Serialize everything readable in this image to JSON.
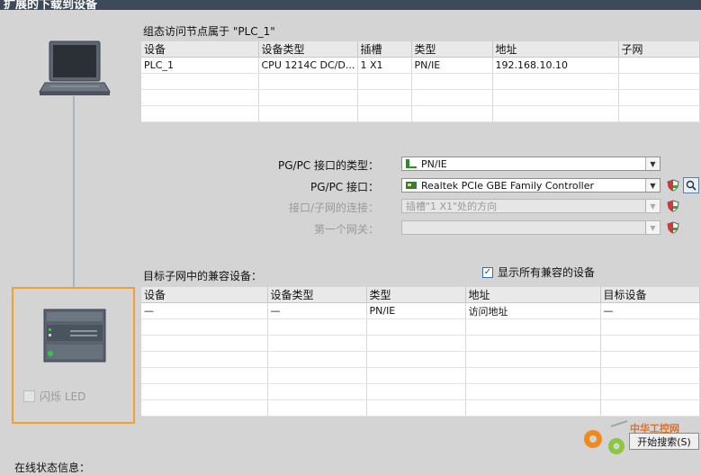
{
  "window": {
    "title": "扩展的下载到设备"
  },
  "left_panel": {
    "flash_led_label": "闪烁 LED"
  },
  "access_section": {
    "title": "组态访问节点属于 \"PLC_1\"",
    "columns": [
      "设备",
      "设备类型",
      "插槽",
      "类型",
      "地址",
      "子网"
    ],
    "rows": [
      [
        "PLC_1",
        "CPU 1214C DC/D...",
        "1 X1",
        "PN/IE",
        "192.168.10.10",
        ""
      ],
      [
        "",
        "",
        "",
        "",
        "",
        ""
      ],
      [
        "",
        "",
        "",
        "",
        "",
        ""
      ],
      [
        "",
        "",
        "",
        "",
        "",
        ""
      ]
    ]
  },
  "interface": {
    "type_label": "PG/PC 接口的类型：",
    "type_value": "PN/IE",
    "pgpc_label": "PG/PC 接口：",
    "pgpc_value": "Realtek PCIe GBE Family Controller",
    "conn_label": "接口/子网的连接：",
    "conn_value": "插槽\"1 X1\"处的方向",
    "gateway_label": "第一个网关：",
    "gateway_value": ""
  },
  "compatible": {
    "title": "目标子网中的兼容设备：",
    "show_all_label": "显示所有兼容的设备",
    "columns": [
      "设备",
      "设备类型",
      "类型",
      "地址",
      "目标设备"
    ],
    "rows": [
      [
        "—",
        "—",
        "PN/IE",
        "访问地址",
        "—"
      ],
      [
        "",
        "",
        "",
        "",
        ""
      ],
      [
        "",
        "",
        "",
        "",
        ""
      ],
      [
        "",
        "",
        "",
        "",
        ""
      ],
      [
        "",
        "",
        "",
        "",
        ""
      ],
      [
        "",
        "",
        "",
        "",
        ""
      ],
      [
        "",
        "",
        "",
        "",
        ""
      ]
    ]
  },
  "actions": {
    "start_search_label": "开始搜索(S)"
  },
  "watermark": {
    "text": "中华工控网"
  },
  "status": {
    "online_info_label": "在线状态信息："
  },
  "colors": {
    "highlight_frame": "#f0a030",
    "titlebar": "#3e4a57"
  }
}
